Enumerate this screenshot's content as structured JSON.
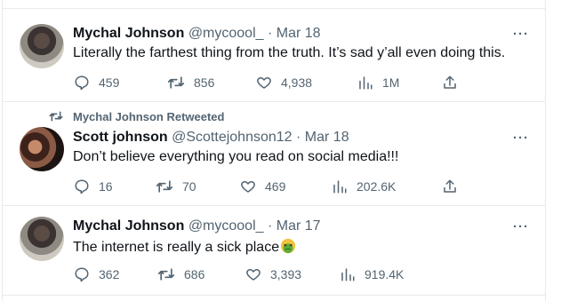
{
  "tweets": [
    {
      "name": "Mychal Johnson",
      "handle": "@mycoool_",
      "sep": "·",
      "date": "Mar 18",
      "text": "Literally the farthest thing from the truth. It’s sad y’all even doing this.",
      "replies": "459",
      "retweets": "856",
      "likes": "4,938",
      "views": "1M",
      "more": "···"
    },
    {
      "retweeted_by": "Mychal Johnson Retweeted",
      "name": "Scott johnson",
      "handle": "@Scottejohnson12",
      "sep": "·",
      "date": "Mar 18",
      "text": "Don’t believe everything you read on social media!!!",
      "replies": "16",
      "retweets": "70",
      "likes": "469",
      "views": "202.6K",
      "more": "···"
    },
    {
      "name": "Mychal Johnson",
      "handle": "@mycoool_",
      "sep": "·",
      "date": "Mar 17",
      "text": "The internet is really a sick place",
      "emoji": "nauseated-face",
      "replies": "362",
      "retweets": "686",
      "likes": "3,393",
      "views": "919.4K",
      "more": "···"
    }
  ],
  "colors": {
    "text": "#0f1419",
    "secondary": "#536471",
    "border": "#e7eaed",
    "emoji_face": "#f2c23a",
    "emoji_green": "#5fae3c"
  }
}
